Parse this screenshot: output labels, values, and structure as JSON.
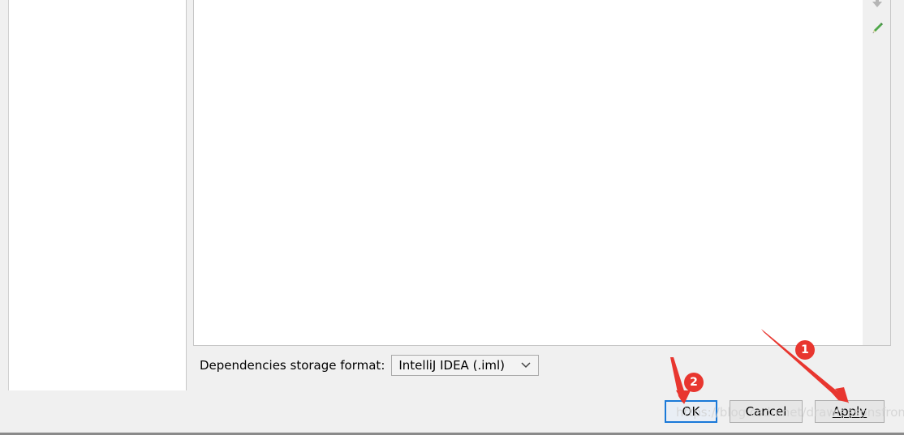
{
  "storage": {
    "label": "Dependencies storage format:",
    "selected": "IntelliJ IDEA (.iml)"
  },
  "buttons": {
    "ok": "OK",
    "cancel": "Cancel",
    "apply": "Apply"
  },
  "annotations": {
    "badge_1": "1",
    "badge_2": "2"
  },
  "watermark": "https://blog.csdn.net/drawlessonsfrom",
  "colors": {
    "ok_focus_border": "#1a79d8",
    "annotation_red": "#e8362f"
  },
  "icons": [
    "arrow-down-icon",
    "edit-pencil-icon",
    "chevron-down-icon"
  ]
}
